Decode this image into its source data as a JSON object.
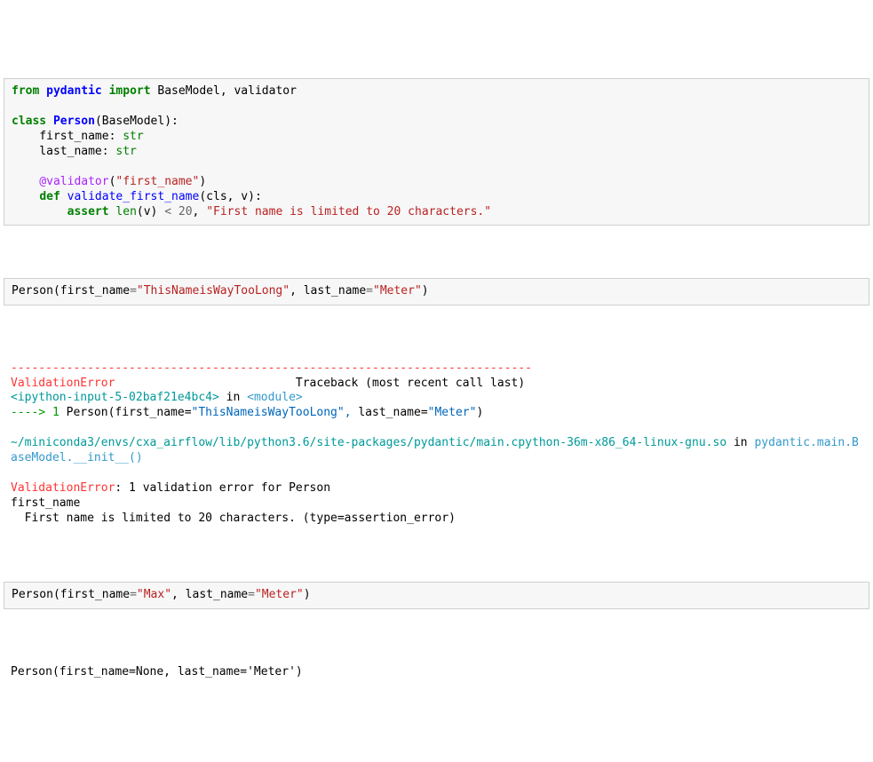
{
  "cell1": {
    "from": "from",
    "pydantic": "pydantic",
    "import": "import",
    "imports": " BaseModel, validator",
    "class_kw": "class",
    "class_name": "Person",
    "base": "(BaseModel):",
    "field1_name": "    first_name: ",
    "field1_type": "str",
    "field2_name": "    last_name: ",
    "field2_type": "str",
    "decorator_at": "    @validator",
    "decorator_arg": "\"first_name\"",
    "def_kw": "def",
    "func_name": "validate_first_name",
    "func_sig": "(cls, v):",
    "assert_kw": "assert",
    "len_call": "len",
    "len_arg": "(v) ",
    "lt": "<",
    "twenty": " 20",
    "comma": ", ",
    "assert_msg": "\"First name is limited to 20 characters.\""
  },
  "cell2": {
    "call_prefix": "Person(first_name",
    "eq1": "=",
    "arg1": "\"ThisNameisWayTooLong\"",
    "mid": ", last_name",
    "eq2": "=",
    "arg2": "\"Meter\"",
    "close": ")"
  },
  "traceback": {
    "dashes": "---------------------------------------------------------------------------",
    "err_name1": "ValidationError",
    "tb_header": "                          Traceback (most recent call last)",
    "ipython": "<ipython-input-5-02baf21e4bc4>",
    "in_": " in ",
    "module": "<module>",
    "arrow": "----> 1",
    "person": " Person",
    "call": "(first_name",
    "eq1": "=",
    "arg1": "\"ThisNameisWayTooLong\",",
    "mid": " last_name",
    "eq2": "=",
    "arg2": "\"Meter\"",
    "close": ")",
    "path": "~/miniconda3/envs/cxa_airflow/lib/python3.6/site-packages/pydantic/main.cpython-36m-x86_64-linux-gnu.so",
    "in2": " in ",
    "func": "pydantic.main.BaseModel.__init__()",
    "err_name2": "ValidationError",
    "err_msg": ": 1 validation error for Person",
    "field": "first_name",
    "detail": "  First name is limited to 20 characters. (type=assertion_error)"
  },
  "cell3": {
    "call_prefix": "Person(first_name",
    "eq1": "=",
    "arg1": "\"Max\"",
    "mid": ", last_name",
    "eq2": "=",
    "arg2": "\"Meter\"",
    "close": ")"
  },
  "output3": {
    "text": "Person(first_name=None, last_name='Meter')"
  }
}
